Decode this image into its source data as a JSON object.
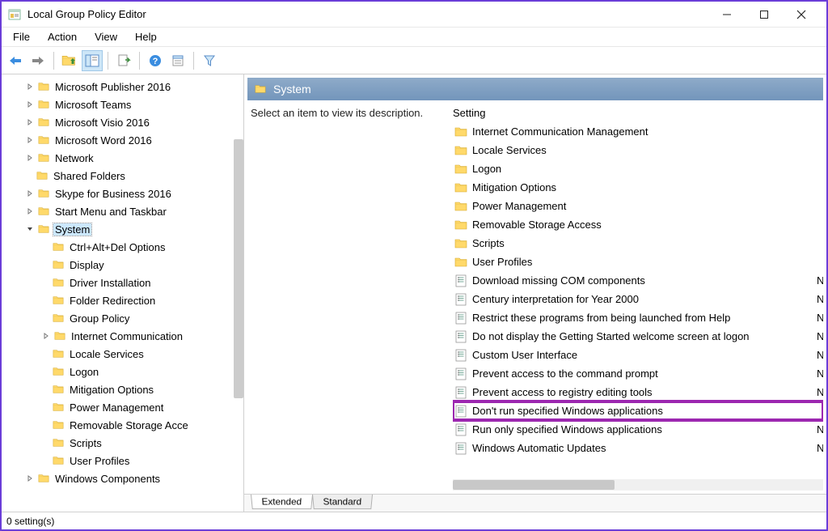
{
  "window": {
    "title": "Local Group Policy Editor"
  },
  "menubar": {
    "items": [
      "File",
      "Action",
      "View",
      "Help"
    ]
  },
  "tree": {
    "items": [
      {
        "indent": 1,
        "chevron": ">",
        "label": "Microsoft Publisher 2016"
      },
      {
        "indent": 1,
        "chevron": ">",
        "label": "Microsoft Teams"
      },
      {
        "indent": 1,
        "chevron": ">",
        "label": "Microsoft Visio 2016"
      },
      {
        "indent": 1,
        "chevron": ">",
        "label": "Microsoft Word 2016"
      },
      {
        "indent": 1,
        "chevron": ">",
        "label": "Network"
      },
      {
        "indent": 1,
        "chevron": "",
        "label": "Shared Folders"
      },
      {
        "indent": 1,
        "chevron": ">",
        "label": "Skype for Business 2016"
      },
      {
        "indent": 1,
        "chevron": ">",
        "label": "Start Menu and Taskbar"
      },
      {
        "indent": 1,
        "chevron": "v",
        "label": "System",
        "selected": true
      },
      {
        "indent": 2,
        "chevron": "",
        "label": "Ctrl+Alt+Del Options"
      },
      {
        "indent": 2,
        "chevron": "",
        "label": "Display"
      },
      {
        "indent": 2,
        "chevron": "",
        "label": "Driver Installation"
      },
      {
        "indent": 2,
        "chevron": "",
        "label": "Folder Redirection"
      },
      {
        "indent": 2,
        "chevron": "",
        "label": "Group Policy"
      },
      {
        "indent": 2,
        "chevron": ">",
        "label": "Internet Communication"
      },
      {
        "indent": 2,
        "chevron": "",
        "label": "Locale Services"
      },
      {
        "indent": 2,
        "chevron": "",
        "label": "Logon"
      },
      {
        "indent": 2,
        "chevron": "",
        "label": "Mitigation Options"
      },
      {
        "indent": 2,
        "chevron": "",
        "label": "Power Management"
      },
      {
        "indent": 2,
        "chevron": "",
        "label": "Removable Storage Acce"
      },
      {
        "indent": 2,
        "chevron": "",
        "label": "Scripts"
      },
      {
        "indent": 2,
        "chevron": "",
        "label": "User Profiles"
      },
      {
        "indent": 1,
        "chevron": ">",
        "label": "Windows Components"
      }
    ]
  },
  "pathHeader": "System",
  "description": "Select an item to view its description.",
  "settingsHeader": "Setting",
  "settings": [
    {
      "type": "folder",
      "name": "Internet Communication Management",
      "state": ""
    },
    {
      "type": "folder",
      "name": "Locale Services",
      "state": ""
    },
    {
      "type": "folder",
      "name": "Logon",
      "state": ""
    },
    {
      "type": "folder",
      "name": "Mitigation Options",
      "state": ""
    },
    {
      "type": "folder",
      "name": "Power Management",
      "state": ""
    },
    {
      "type": "folder",
      "name": "Removable Storage Access",
      "state": ""
    },
    {
      "type": "folder",
      "name": "Scripts",
      "state": ""
    },
    {
      "type": "folder",
      "name": "User Profiles",
      "state": ""
    },
    {
      "type": "policy",
      "name": "Download missing COM components",
      "state": "N"
    },
    {
      "type": "policy",
      "name": "Century interpretation for Year 2000",
      "state": "N"
    },
    {
      "type": "policy",
      "name": "Restrict these programs from being launched from Help",
      "state": "N"
    },
    {
      "type": "policy",
      "name": "Do not display the Getting Started welcome screen at logon",
      "state": "N"
    },
    {
      "type": "policy",
      "name": "Custom User Interface",
      "state": "N"
    },
    {
      "type": "policy",
      "name": "Prevent access to the command prompt",
      "state": "N"
    },
    {
      "type": "policy",
      "name": "Prevent access to registry editing tools",
      "state": "N"
    },
    {
      "type": "policy",
      "name": "Don't run specified Windows applications",
      "state": "",
      "highlighted": true
    },
    {
      "type": "policy",
      "name": "Run only specified Windows applications",
      "state": "N"
    },
    {
      "type": "policy",
      "name": "Windows Automatic Updates",
      "state": "N"
    }
  ],
  "tabs": {
    "active": "Extended",
    "other": "Standard"
  },
  "statusbar": "0 setting(s)"
}
